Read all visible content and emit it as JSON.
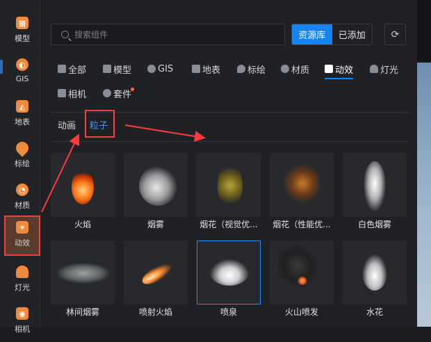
{
  "sidebar": {
    "items": [
      {
        "label": "模型",
        "icon": "model-icon"
      },
      {
        "label": "GIS",
        "icon": "globe-icon"
      },
      {
        "label": "地表",
        "icon": "terrain-icon"
      },
      {
        "label": "标绘",
        "icon": "pin-icon"
      },
      {
        "label": "材质",
        "icon": "material-icon"
      },
      {
        "label": "动效",
        "icon": "effect-icon"
      },
      {
        "label": "灯光",
        "icon": "light-icon"
      },
      {
        "label": "相机",
        "icon": "camera-icon"
      }
    ]
  },
  "search": {
    "placeholder": "搜索组件"
  },
  "source_tabs": {
    "library": "资源库",
    "added": "已添加"
  },
  "categories": [
    "全部",
    "模型",
    "GIS",
    "地表",
    "标绘",
    "材质",
    "动效",
    "灯光",
    "相机",
    "套件"
  ],
  "subtabs": [
    "动画",
    "粒子"
  ],
  "assets": [
    {
      "name": "火焰"
    },
    {
      "name": "烟雾"
    },
    {
      "name": "烟花（视觉优..."
    },
    {
      "name": "烟花（性能优..."
    },
    {
      "name": "白色烟雾"
    },
    {
      "name": "林间烟雾"
    },
    {
      "name": "喷射火焰"
    },
    {
      "name": "喷泉"
    },
    {
      "name": "火山喷发"
    },
    {
      "name": "水花"
    }
  ],
  "colors": {
    "accent": "#1484f4",
    "annotation": "#ff3b3b",
    "icon_orange": "#f08a3c"
  }
}
